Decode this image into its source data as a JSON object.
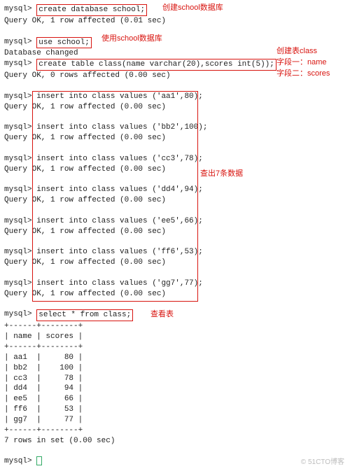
{
  "prompt": "mysql>",
  "cmd_create_db": "create database school;",
  "res_create_db": "Query OK, 1 row affected (0.01 sec)",
  "anno_create_db": "创建school数据库",
  "cmd_use": "use school;",
  "res_use": "Database changed",
  "anno_use": "使用school数据库",
  "cmd_create_tbl": "create table class(name varchar(20),scores int(5));",
  "res_create_tbl": "Query OK, 0 rows affected (0.00 sec)",
  "anno_create_tbl_1": "创建表class",
  "anno_create_tbl_2": "字段一：name",
  "anno_create_tbl_3": "字段二：scores",
  "inserts": [
    {
      "cmd": "insert into class values ('aa1',80);",
      "res": "Query OK, 1 row affected (0.00 sec)"
    },
    {
      "cmd": "insert into class values ('bb2',100);",
      "res": "Query OK, 1 row affected (0.00 sec)"
    },
    {
      "cmd": "insert into class values ('cc3',78);",
      "res": "Query OK, 1 row affected (0.00 sec)"
    },
    {
      "cmd": "insert into class values ('dd4',94);",
      "res": "Query OK, 1 row affected (0.00 sec)"
    },
    {
      "cmd": "insert into class values ('ee5',66);",
      "res": "Query OK, 1 row affected (0.00 sec)"
    },
    {
      "cmd": "insert into class values ('ff6',53);",
      "res": "Query OK, 1 row affected (0.00 sec)"
    },
    {
      "cmd": "insert into class values ('gg7',77);",
      "res": "Query OK, 1 row affected (0.00 sec)"
    }
  ],
  "anno_inserts": "查出7条数据",
  "cmd_select": "select * from class;",
  "anno_select": "查看表",
  "table_border": "+------+--------+",
  "table_header": "| name | scores |",
  "table_rows": [
    "| aa1  |     80 |",
    "| bb2  |    100 |",
    "| cc3  |     78 |",
    "| dd4  |     94 |",
    "| ee5  |     66 |",
    "| ff6  |     53 |",
    "| gg7  |     77 |"
  ],
  "table_footer": "7 rows in set (0.00 sec)",
  "watermark": "© 51CTO博客",
  "chart_data": {
    "type": "table",
    "title": "class",
    "columns": [
      "name",
      "scores"
    ],
    "rows": [
      [
        "aa1",
        80
      ],
      [
        "bb2",
        100
      ],
      [
        "cc3",
        78
      ],
      [
        "dd4",
        94
      ],
      [
        "ee5",
        66
      ],
      [
        "ff6",
        53
      ],
      [
        "gg7",
        77
      ]
    ]
  }
}
